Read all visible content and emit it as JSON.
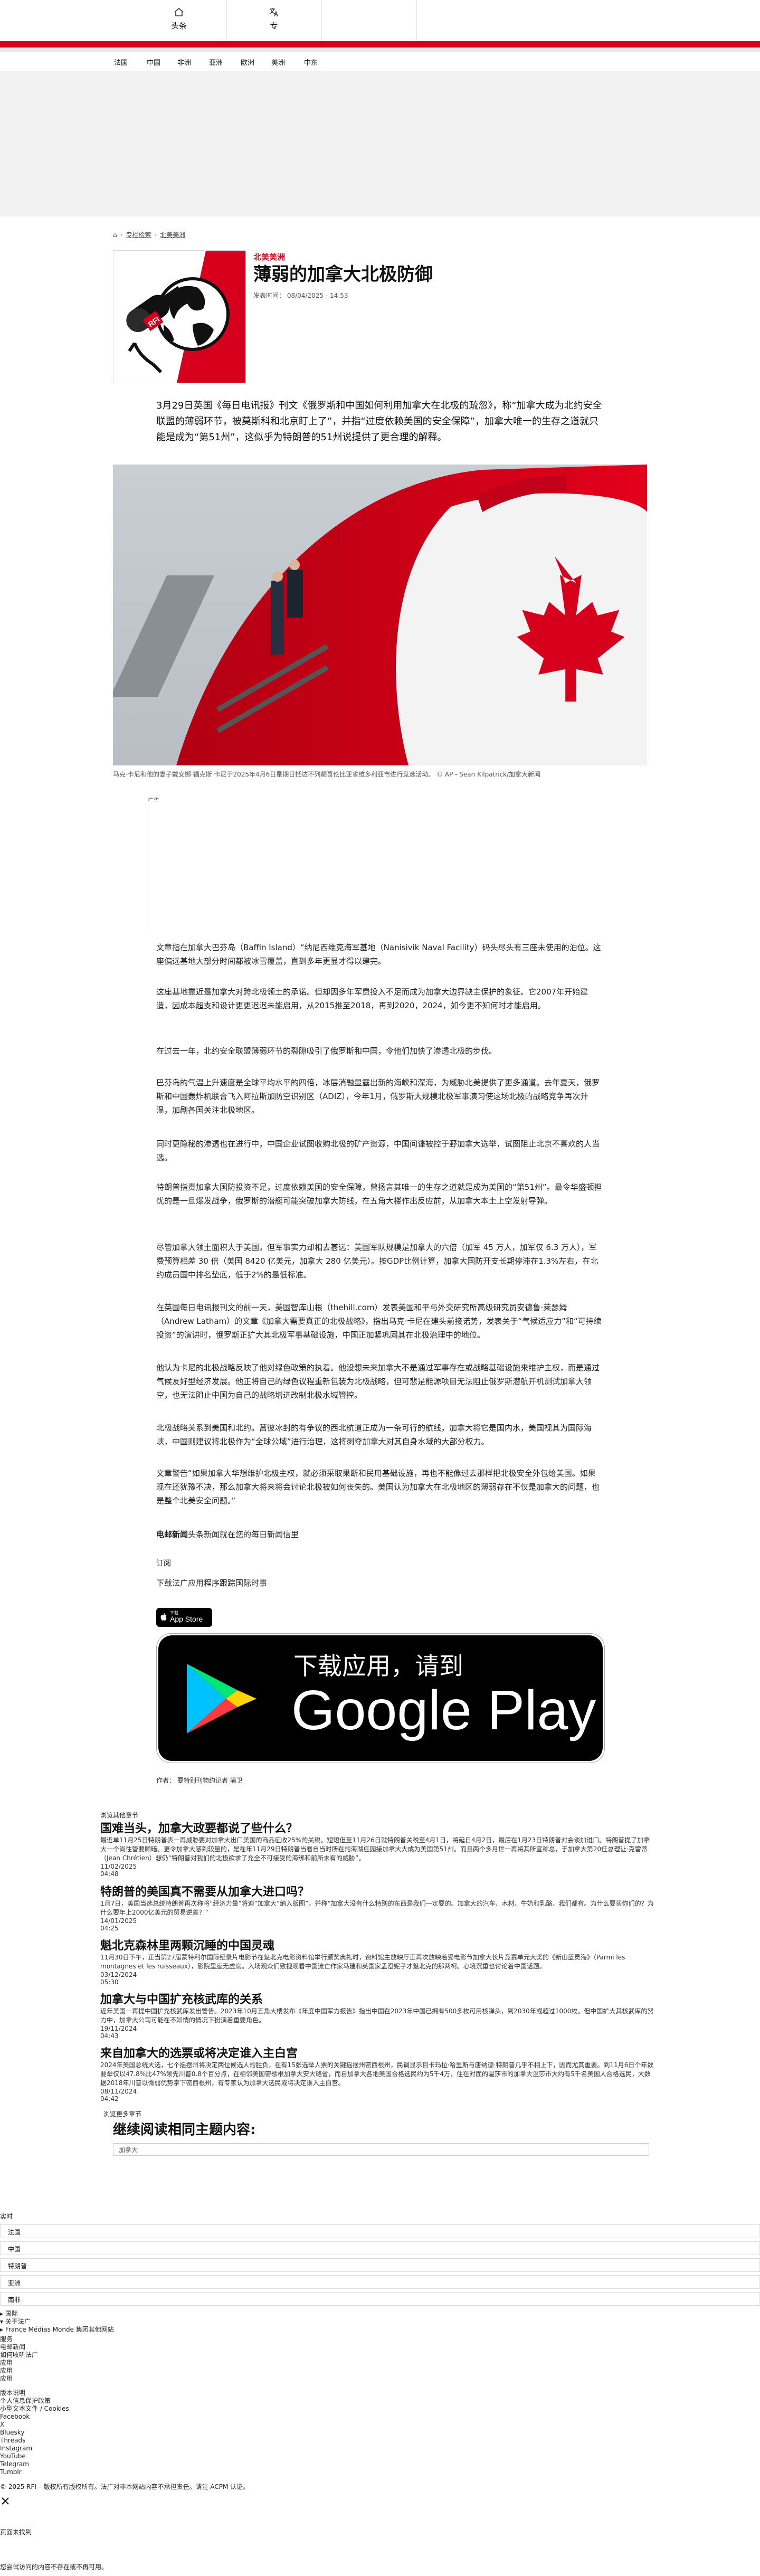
{
  "topnav": {
    "home_label": "头条",
    "docs_label": "专"
  },
  "secnav": [
    "法国",
    "中国",
    "非洲",
    "亚洲",
    "欧洲",
    "美洲",
    "中东"
  ],
  "breadcrumb": [
    "​专栏检索",
    "​北美美洲"
  ],
  "thumb": {
    "logo_text": "RFI"
  },
  "article": {
    "kicker": "北美美洲",
    "title": "薄弱的加拿大北极防御",
    "meta": "发表时间： 08/04/2025 - 14:53",
    "lede": "3月29日英国《每日电讯报》刊文《俄罗斯和中国如何利用加拿大在北极的疏忽》，称“加拿大成为北约安全联盟的薄弱环节，被莫斯科和北京盯上了”，并指“过度依赖美国的安全保障”，加拿大唯一的生存之道就只能是成为“第51州”，这似乎为特朗普的51州说提供了更合理的解释。",
    "caption": "马克·卡尼和他的妻子戴安娜·福克斯·卡尼于2025年4月6日星期日抵达不列颠哥伦比亚省维多利亚市进行竞选活动。 © AP - Sean Kilpatrick/加拿大新闻",
    "ad_label": "广告",
    "paragraphs": [
      "文章指在加拿大巴芬岛（Baffin Island）“纳尼西维克海军基地（Nanisivik Naval Facility）码头尽头有三座未使用的泊位。这座偏远基地大部分时间都被冰雪覆盖，直到多年更显才得以建完。",
      "这座基地靠近最加拿大对跨北极领土的承诺。但却因多年军费投入不足而成为加拿大边界缺主保护的象征。它2007年开始建造，因成本超支和设计更更迟迟未能启用，从2015推至2018，再到2020，2024，如今更不知何时才能启用。",
      "在过去一年，北约安全联盟薄弱环节的裂隙吸引了俄罗斯和中国，令他们加快了渗透北极的步伐。",
      "巴芬岛的气温上升速度是全球平均水平的四倍，冰层消融显露出新的海峡和深海，为威胁北美提供了更多通道。去年夏天，俄罗斯和中国轰炸机联合飞入阿拉斯加防空识别区（ADIZ），今年1月，俄罗斯大规模北极军事演习使这场北极的战略竞争再次升温，加剧各国关注北极地区。",
      "同时更隐秘的渗透也在进行中，中国企业试图收购北极的矿产资源，中国间谍被控于野加拿大选举，试图阻止北京不喜欢的人当选。",
      "特朗普指责加拿大国防投资不足，过度依赖美国的安全保障，曾扬言其唯一的生存之道就是成为美国的“第51州”。最令华盛顿担忧的是一旦爆发战争，俄罗斯的潜艇可能突破加拿大防线，在五角大楼作出反应前，从加拿大本土上空发射导弹。",
      "尽管加拿大领土面积大于美国，但军事实力却相去甚远：美国军队规模是加拿大的六倍（加军 45 万人，加军仅 6.3 万人），军费预算相差 30 倍（美国 8420 亿美元，加拿大 280 亿美元）。按GDP比例计算，加拿大国防开支长期停滞在1.3%左右，在北约成员国中排名垫底，低于2%的最低标准。",
      "在英国每日电讯报刊文的前一天，美国智库山根（thehill.com）发表美国和平与外交研究所高级研究员安德鲁·莱瑟姆（Andrew Latham）的文章《加拿大需要真正的北极战略》，指出马克·卡尼在建头前接诺势，发表关于“气候适应力”和“可持续投资”的演讲时，俄罗斯正扩大其北极军事基础设施，中国正加紧巩固其在北极治理中的地位。",
      "他认为卡尼的北极战略反映了他对绿色政策的执着。他设想未来加拿大不是通过军事存在或战略基础设施来维护主权，而是通过气候友好型经济发展。他正将自己的绿色议程重新包装为北极战略，但可悲是能源项目无法阻止俄罗斯潜航开机测试加拿大领空，也无法阻止中国为自己的战略增进改制北极水域管控。",
      "北极战略关系到美国和北约。莒彼冰封的有争议的西北航道正成为一条可行的航线，加拿大将它是国内水，美国视其为国际海峡，中国则建议将北极作为“全球公域”进行治理，这将剥夺加拿大对其自身水域的大部分权力。",
      "文章警告“如果加拿大华想维护北极主权，就必须采取果断和民用基础设施，再也不能像过去那样把北极安全外包给美国。如果现在还犹豫不决，那么加拿大将来将会讨论北极被如何丧失的。美国认为加拿大在北极地区的薄弱存在不仅是加拿大的问题，也是整个北美安全问题。”"
    ],
    "promo_bold": "电邮新闻",
    "promo_rest": "头条新闻就在您的每日新闻信里",
    "subscribe": "订阅",
    "download_line": "下载法广应用程序跟踪国际时事",
    "appstore_small": "下载",
    "appstore_big": "App Store",
    "gplay_top": "下载应用，请到",
    "gplay_big": "Google Play",
    "author": "作者： 要特别刊物约记者 蒲卫"
  },
  "more": {
    "label": "浏览其他章节",
    "items": [
      {
        "title": "国难当头，加拿大政要都说了些什么？",
        "desc": "最近单11月25日特朗普表一再威胁要对加拿大出口美国的商品征收25%的关税。短短但至11月26日就特朗普关税至4月1日，将延日4月2日，最后在1月23日特朗普对会谈加进口。特朗普提了加拿大一个尚往管要顾暗。更令加拿大感到较量的，是在年11月29日特朗普当看自当时所在的海湖庄园接加拿大大成为美国第51州。而且两个多月世一再将其所宣称总，于加拿大第20任总理让·克雷蒂（Jean Chrétien）想仍“特朗普对我们的北极欲求了充全不可接受的海绑和前所未有的威胁”。",
        "date": "11/02/2025",
        "time": "04:48"
      },
      {
        "title": "特朗普的美国真不需要从加拿大进口吗？",
        "desc": "1月7日，美国当选总统特朗普再次称将“经济力量”将迫“加拿大”纳入版图”，并称“加拿大没有什么特别的东西是我们一定要的。加拿大的汽车、木材、牛奶和乳酪、我们都有。为什么要买你们的？为什么要年上2000亿美元的贸易逆差？”",
        "date": "14/01/2025",
        "time": "04:25"
      },
      {
        "title": "魁北克森林里两颗沉睡的中国灵魂",
        "desc": "11月30日下午，正当第27届蒙特利尔国际纪录片电影节在魁北克电影资料馆举行颁奖典礼时，资料馆主放映厅正再次放映着受电影节加拿大长片竞赛单元大奖的《新山蓝灵海》（Parmi les montagnes et les ruisseaux），影院里座无虚席。入场观众们致视观看中国流亡作家马建和英国家孟澄妮子才魁北克的那两柯。心境沉重也讨论着中国话题。",
        "date": "03/12/2024",
        "time": "05:30"
      },
      {
        "title": "加拿大与中国扩充核武库的关系",
        "desc": "近年美国一再提中国扩充核武库发出警告。2023年10月五角大楼发布《年度中国军力报告》指出中国在2023年中国已拥有500多枚可用核弹头，到2030年或超过1000枚。但中国扩大其核武库的努力中，加拿大公司可能在不知情的情况下扮演着重要角色。",
        "date": "19/11/2024",
        "time": "04:43"
      },
      {
        "title": "来自加拿大的选票或将决定谁入主白宫",
        "desc": "2024年美国总统大选，七个摇摆州将决定两位候选人的胜负，在有15张选举人票的关键摇摆州密西根州，民调显示目卡玛拉·哈里斯与唐纳德·特朗普几乎不相上下，因而尤其重要。到11月6日个年数要举仅以47.8%比47%领先川普0.8个百分点，在相邻美国密歇根加拿大安大略省，而自加拿大各地美国合格选民约为5千4万，住在对面的温莎市的加拿大温莎市大约有5千名美国人合格选民，大数据2018年川普以微弱优势掌下密西根州，有专家认为加拿大选民或将决定谁入主白宫。",
        "date": "08/11/2024",
        "time": "04:42"
      }
    ],
    "also_label": "浏览更多章节",
    "related_title": "继续阅读相同主题内容:",
    "related_input": "加拿大"
  },
  "footer": {
    "live": "实时",
    "langs": [
      "法国",
      "中国",
      "特朗普",
      "亚洲",
      "南非"
    ],
    "links_a": [
      "国际",
      "关于法广",
      "France Médias Monde 集团其他网站"
    ],
    "links_b": [
      "服务",
      "电邮新闻",
      "如何收听法广",
      "应用",
      "应用",
      "应用"
    ],
    "links_c": [
      "版本说明",
      "个人信息保护政策",
      "小型文本文件 / Cookies",
      "Facebook",
      "X",
      "Bluesky",
      "Threads",
      "Instagram",
      "YouTube",
      "Telegram",
      "Tumblr"
    ],
    "copyright": "© 2025 RFI – 版权所有版权所有。法广对非本网站内容不承担责任。请注 ACPM 认证。",
    "notfound": "页面未找到",
    "notfound_msg": "您尝试访问的内容不存在或不再可用。"
  }
}
